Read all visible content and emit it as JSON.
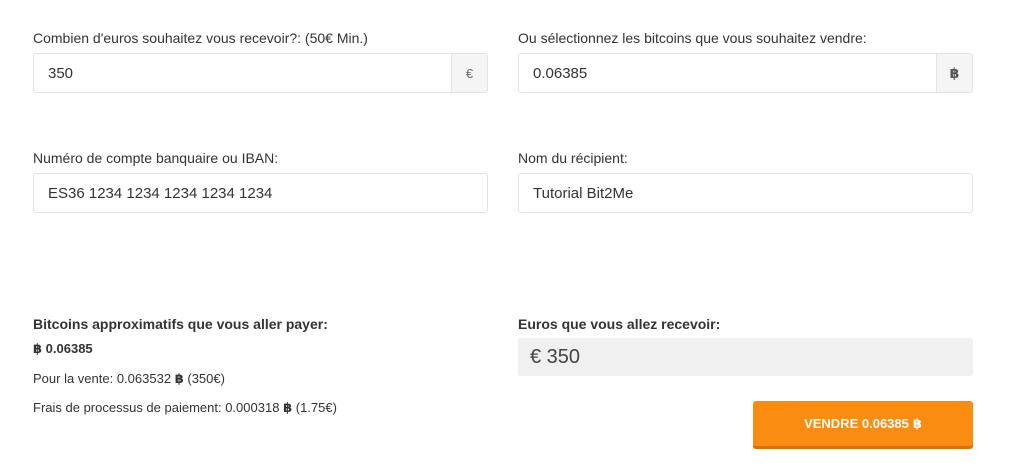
{
  "form": {
    "euros_amount": {
      "label": "Combien d'euros souhaitez vous recevoir?: (50€ Min.)",
      "value": "350",
      "addon": "€"
    },
    "bitcoin_amount": {
      "label": "Ou sélectionnez les bitcoins que vous souhaitez vendre:",
      "value": "0.06385",
      "addon": "฿"
    },
    "iban": {
      "label": "Numéro de compte banquaire ou IBAN:",
      "value": "ES36 1234 1234 1234 1234 1234"
    },
    "recipient": {
      "label": "Nom du récipient:",
      "value": "Tutorial Bit2Me"
    }
  },
  "summary": {
    "pay_title": "Bitcoins approximatifs que vous aller payer:",
    "pay_symbol": "฿",
    "pay_amount": "0.06385",
    "sale_prefix": "Pour la vente: 0.063532",
    "sale_symbol": "฿",
    "sale_suffix": "(350€)",
    "fee_prefix": "Frais de processus de paiement: 0.000318",
    "fee_symbol": "฿",
    "fee_suffix": "(1.75€)",
    "receive_title": "Euros que vous allez recevoir:",
    "receive_amount": "€ 350"
  },
  "actions": {
    "sell_label": "VENDRE 0.06385",
    "sell_symbol": "฿"
  },
  "colors": {
    "accent": "#fb8c12",
    "accent_shadow": "#d97204",
    "field_border": "#e3e3e3",
    "addon_bg": "#f5f5f5",
    "receive_bg": "#f0f0f0"
  }
}
